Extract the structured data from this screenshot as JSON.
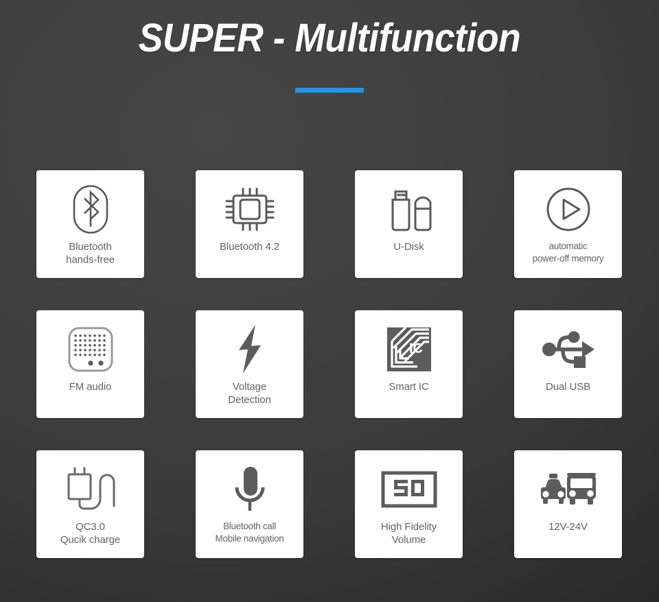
{
  "header": {
    "title": "SUPER - Multifunction",
    "accent_color": "#1c96f0"
  },
  "theme": {
    "background_dark": "#3a3a3a",
    "tile_background": "#ffffff",
    "icon_color": "#595959",
    "label_color": "#636363",
    "title_color": "#ffffff"
  },
  "features": [
    {
      "icon": "bluetooth-icon",
      "label": "Bluetooth\nhands-free",
      "label_size": "normal"
    },
    {
      "icon": "chip-icon",
      "label": "Bluetooth 4.2",
      "label_size": "normal"
    },
    {
      "icon": "usb-flash-drive-icon",
      "label": "U-Disk",
      "label_size": "normal"
    },
    {
      "icon": "play-circle-icon",
      "label": "automatic\npower-off memory",
      "label_size": "small"
    },
    {
      "icon": "radio-icon",
      "label": "FM audio",
      "label_size": "normal"
    },
    {
      "icon": "lightning-bolt-icon",
      "label": "Voltage\nDetection",
      "label_size": "normal"
    },
    {
      "icon": "nfc-smart-card-icon",
      "label": "Smart IC",
      "label_size": "normal"
    },
    {
      "icon": "usb-trident-icon",
      "label": "Dual USB",
      "label_size": "normal"
    },
    {
      "icon": "power-adapter-icon",
      "label": "QC3.0\nQucik charge",
      "label_size": "normal"
    },
    {
      "icon": "microphone-icon",
      "label": "Bluetooth call\nMobile navigation",
      "label_size": "small"
    },
    {
      "icon": "volume-display-icon",
      "label": "High Fidelity\nVolume",
      "label_size": "normal",
      "display_value": "50"
    },
    {
      "icon": "car-and-bus-icon",
      "label": "12V-24V",
      "label_size": "normal"
    }
  ]
}
